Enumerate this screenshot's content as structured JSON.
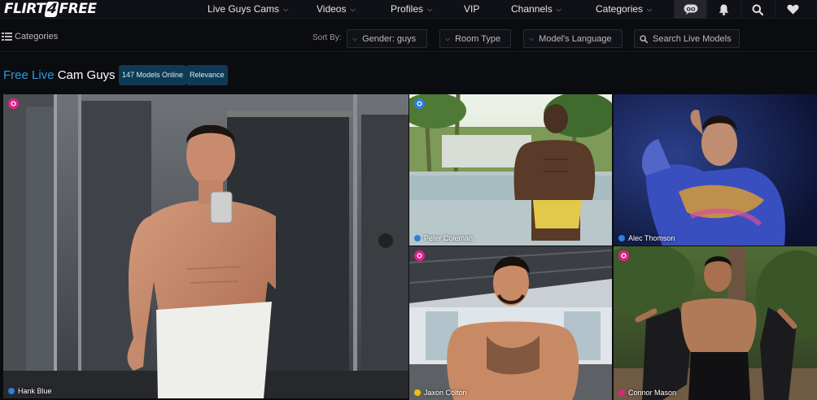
{
  "brand": {
    "logo_left": "FLIRT",
    "logo_mid": "4",
    "logo_right": "FREE"
  },
  "nav": {
    "items": [
      {
        "label": "Live Guys Cams",
        "dropdown": true
      },
      {
        "label": "Videos",
        "dropdown": true
      },
      {
        "label": "Profiles",
        "dropdown": true
      },
      {
        "label": "VIP",
        "dropdown": false
      },
      {
        "label": "Channels",
        "dropdown": true
      },
      {
        "label": "Categories",
        "dropdown": true
      }
    ],
    "icons": [
      "chat-icon",
      "bell-icon",
      "search-icon",
      "heart-icon"
    ],
    "chat_glyph": "OO"
  },
  "toolbar": {
    "categories_label": "Categories",
    "sort_by_label": "Sort By:",
    "filters": [
      "Gender: guys",
      "Room Type",
      "Model's Language"
    ],
    "search_placeholder": "Search Live Models"
  },
  "section": {
    "title_free": "Free Live",
    "title_rest": "Cam Guys",
    "models_online": "147 Models Online",
    "sort_value": "Relevance"
  },
  "colors": {
    "accent_blue": "#2a9ae0",
    "dot_blue": "#2f7fd8",
    "dot_yellow": "#f2c200",
    "dot_pink": "#e0218a"
  },
  "models": [
    {
      "name": "Hank Blue",
      "status": "blue",
      "badge": "pink"
    },
    {
      "name": "Peter Coleman",
      "status": "blue",
      "badge": "blue"
    },
    {
      "name": "Alec Thomson",
      "status": "blue",
      "badge": ""
    },
    {
      "name": "Jaxon Colton",
      "status": "yellow",
      "badge": "pink"
    },
    {
      "name": "Connor Mason",
      "status": "pink",
      "badge": "pink"
    }
  ]
}
